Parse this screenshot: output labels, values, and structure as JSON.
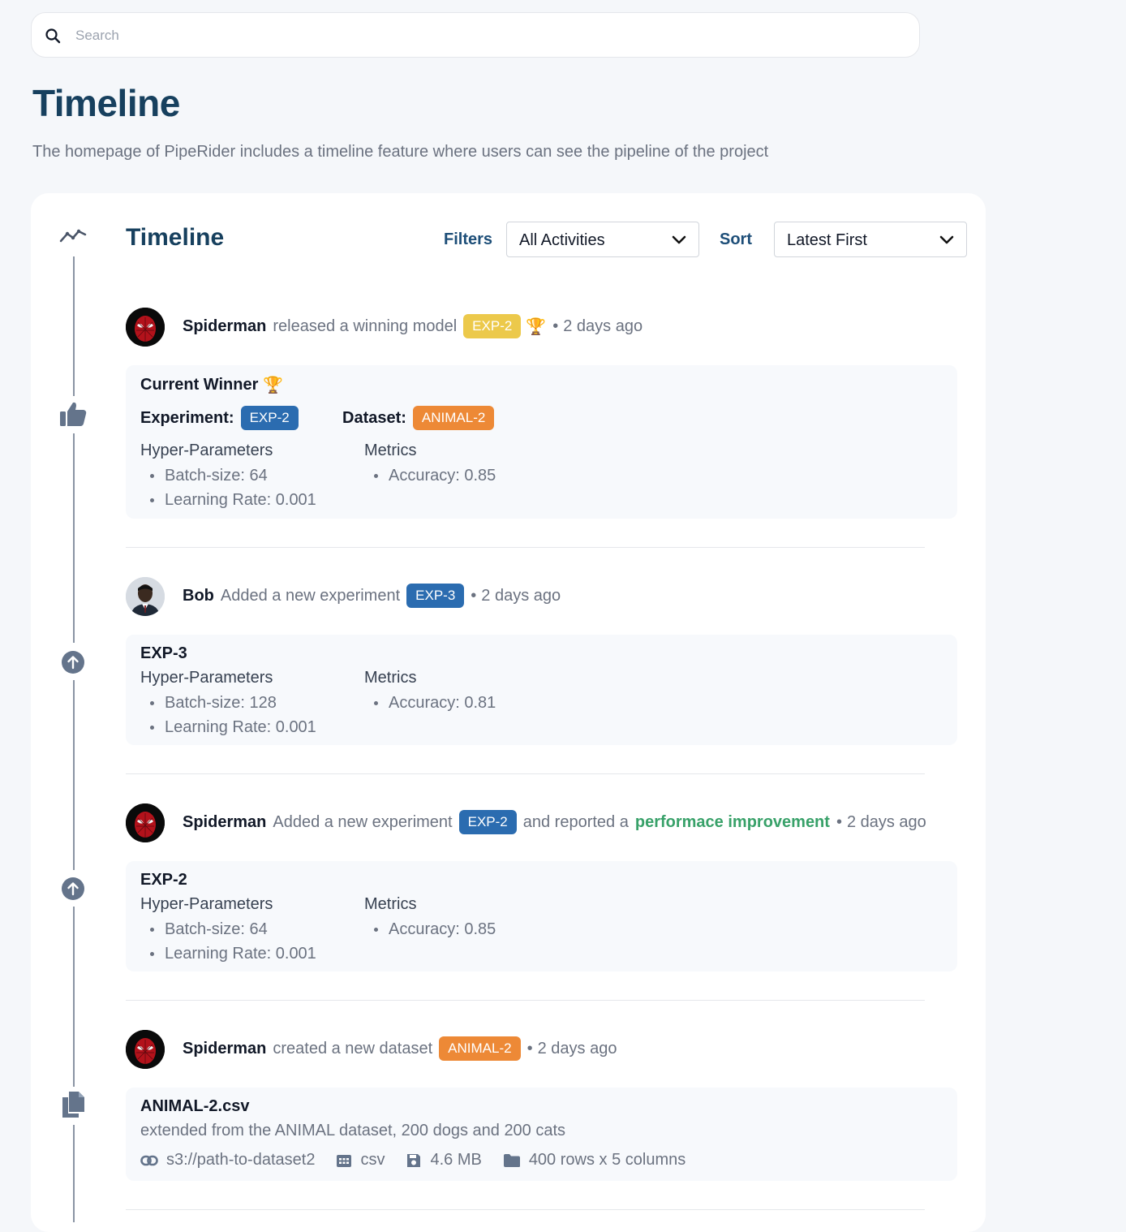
{
  "search": {
    "placeholder": "Search"
  },
  "page": {
    "title": "Timeline",
    "subtitle": "The homepage of PipeRider includes a timeline feature where users can see the pipeline of the project"
  },
  "timeline": {
    "title": "Timeline",
    "filters_label": "Filters",
    "filters_value": "All Activities",
    "sort_label": "Sort",
    "sort_value": "Latest First"
  },
  "activities": [
    {
      "user": "Spiderman",
      "verb": "released a winning model",
      "badge": "EXP-2",
      "badge_color": "#ecc94b",
      "trophy": "🏆",
      "separator": "•",
      "time": "2 days ago",
      "rail_icon": "thumbs-up-icon",
      "panel": {
        "title": "Current Winner",
        "title_icon": "🏆",
        "experiment_label": "Experiment:",
        "experiment_value": "EXP-2",
        "dataset_label": "Dataset:",
        "dataset_value": "ANIMAL-2",
        "hyper_label": "Hyper-Parameters",
        "hyper": [
          "Batch-size: 64",
          "Learning Rate: 0.001"
        ],
        "metrics_label": "Metrics",
        "metrics": [
          "Accuracy: 0.85"
        ]
      }
    },
    {
      "user": "Bob",
      "verb": "Added a new experiment",
      "badge": "EXP-3",
      "badge_color": "#2b6cb0",
      "separator": "•",
      "time": "2 days ago",
      "rail_icon": "arrow-up-circle-icon",
      "panel": {
        "title": "EXP-3",
        "hyper_label": "Hyper-Parameters",
        "hyper": [
          "Batch-size: 128",
          "Learning Rate: 0.001"
        ],
        "metrics_label": "Metrics",
        "metrics": [
          "Accuracy: 0.81"
        ]
      }
    },
    {
      "user": "Spiderman",
      "verb": "Added a new experiment",
      "badge": "EXP-2",
      "badge_color": "#2b6cb0",
      "after_text": "and reported a",
      "highlight": "performace improvement",
      "highlight_color": "#38a169",
      "separator": "•",
      "time": "2 days ago",
      "rail_icon": "arrow-up-circle-icon",
      "panel": {
        "title": "EXP-2",
        "hyper_label": "Hyper-Parameters",
        "hyper": [
          "Batch-size: 64",
          "Learning Rate: 0.001"
        ],
        "metrics_label": "Metrics",
        "metrics": [
          "Accuracy: 0.85"
        ]
      }
    },
    {
      "user": "Spiderman",
      "verb": "created a new dataset",
      "badge": "ANIMAL-2",
      "badge_color": "#ed8936",
      "separator": "•",
      "time": "2 days ago",
      "rail_icon": "copy-files-icon",
      "panel": {
        "title": "ANIMAL-2.csv",
        "description": "extended from the ANIMAL dataset, 200 dogs and 200 cats",
        "path": "s3://path-to-dataset2",
        "format": "csv",
        "size": "4.6 MB",
        "shape": "400 rows x 5 columns"
      }
    }
  ],
  "colors": {
    "title": "#17405e",
    "accent_blue": "#2b6cb0",
    "accent_orange": "#ed8936",
    "accent_yellow": "#ecc94b",
    "success_green": "#38a169"
  }
}
